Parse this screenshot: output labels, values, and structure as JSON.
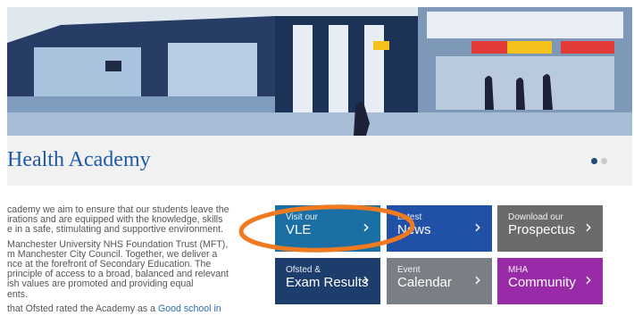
{
  "page": {
    "title": "Health Academy"
  },
  "slider": {
    "dots": [
      {
        "active": true
      },
      {
        "active": false
      }
    ]
  },
  "intro": {
    "paragraph_1": [
      "cademy we aim to ensure that our students leave the",
      "irations and are equipped with the knowledge, skills",
      "e in a safe, stimulating and supportive environment."
    ],
    "paragraph_2": [
      "Manchester University NHS Foundation Trust (MFT),",
      "m Manchester City Council. Together, we deliver a",
      "nce at the forefront of Secondary Education. The",
      "principle of access to a broad, balanced and relevant",
      "ish values are promoted and providing equal",
      "ents."
    ],
    "paragraph_3_prefix": "that Ofsted rated the Academy as a ",
    "paragraph_3_link": "Good school in"
  },
  "tiles": [
    {
      "id": "vle",
      "small": "Visit our",
      "big": "VLE",
      "color": "#1c6fa4"
    },
    {
      "id": "news",
      "small": "Latest",
      "big": "News",
      "color": "#2151a7"
    },
    {
      "id": "prospectus",
      "small": "Download our",
      "big": "Prospectus",
      "color": "#6b6b6b"
    },
    {
      "id": "ofsted",
      "small": "Ofsted &",
      "big": "Exam Results",
      "color": "#1d3d6d"
    },
    {
      "id": "calendar",
      "small": "Event",
      "big": "Calendar",
      "color": "#7a7f85"
    },
    {
      "id": "community",
      "small": "MHA",
      "big": "Community",
      "color": "#9a2ba8"
    }
  ],
  "chevron": "›",
  "colors": {
    "heading": "#1f5aa6",
    "link": "#2a6bb5",
    "annotation_ring": "#f07a1f"
  }
}
